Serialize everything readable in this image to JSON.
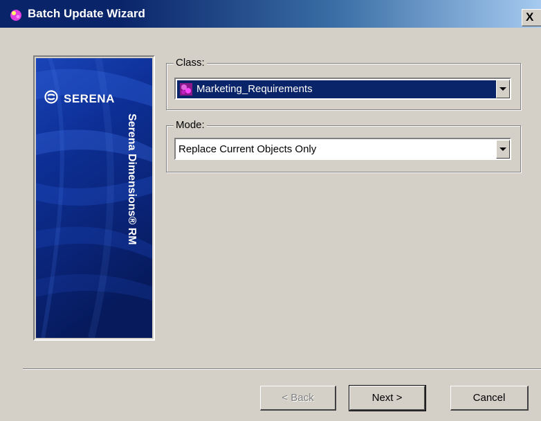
{
  "window": {
    "title": "Batch Update Wizard",
    "close_label": "X"
  },
  "banner": {
    "brand": "SERENA",
    "product": "Serena Dimensions® RM",
    "background_color": "#0b2a86"
  },
  "class_group": {
    "label": "Class:",
    "value": "Marketing_Requirements",
    "icon": "class-icon"
  },
  "mode_group": {
    "label": "Mode:",
    "value": "Replace Current Objects Only"
  },
  "buttons": {
    "back": "< Back",
    "next": "Next >",
    "cancel": "Cancel"
  },
  "colors": {
    "title_bar": "#0a246a",
    "selection": "#0a246a",
    "dialog_face": "#d4d0c8"
  }
}
